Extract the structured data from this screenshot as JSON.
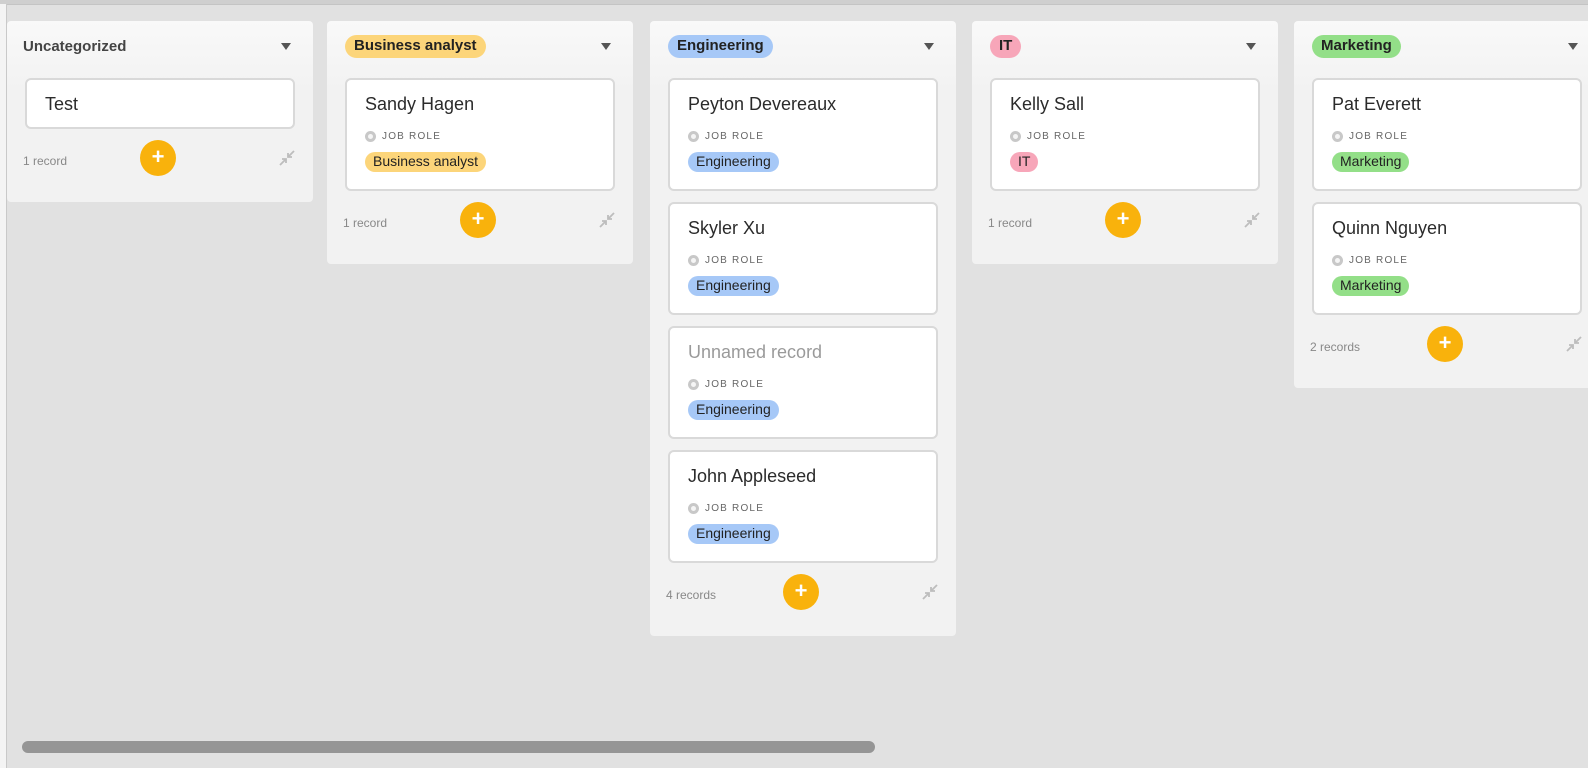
{
  "columns": [
    {
      "title": "Uncategorized",
      "pill": false,
      "cards": [
        {
          "title": "Test",
          "short": true
        }
      ],
      "count": "1 record"
    },
    {
      "title": "Business analyst",
      "pill": true,
      "color": "#fcd57a",
      "cards": [
        {
          "title": "Sandy Hagen",
          "field": "JOB ROLE",
          "tag": "Business analyst"
        }
      ],
      "count": "1 record"
    },
    {
      "title": "Engineering",
      "pill": true,
      "color": "#a6c8f7",
      "cards": [
        {
          "title": "Peyton Devereaux",
          "field": "JOB ROLE",
          "tag": "Engineering"
        },
        {
          "title": "Skyler Xu",
          "field": "JOB ROLE",
          "tag": "Engineering"
        },
        {
          "title": "Unnamed record",
          "muted": true,
          "field": "JOB ROLE",
          "tag": "Engineering"
        },
        {
          "title": "John Appleseed",
          "field": "JOB ROLE",
          "tag": "Engineering"
        }
      ],
      "count": "4 records"
    },
    {
      "title": "IT",
      "pill": true,
      "color": "#f7a6b9",
      "cards": [
        {
          "title": "Kelly Sall",
          "field": "JOB ROLE",
          "tag": "IT"
        }
      ],
      "count": "1 record"
    },
    {
      "title": "Marketing",
      "pill": true,
      "color": "#93df88",
      "cards": [
        {
          "title": "Pat Everett",
          "field": "JOB ROLE",
          "tag": "Marketing"
        },
        {
          "title": "Quinn Nguyen",
          "field": "JOB ROLE",
          "tag": "Marketing"
        }
      ],
      "count": "2 records"
    }
  ],
  "add_label": "+",
  "colors": {
    "add_button": "#f9b20c",
    "background": "#e1e1e1"
  },
  "icons": {
    "caret": "caret-down-icon",
    "collapse": "collapse-arrows-icon",
    "field": "select-field-icon"
  }
}
